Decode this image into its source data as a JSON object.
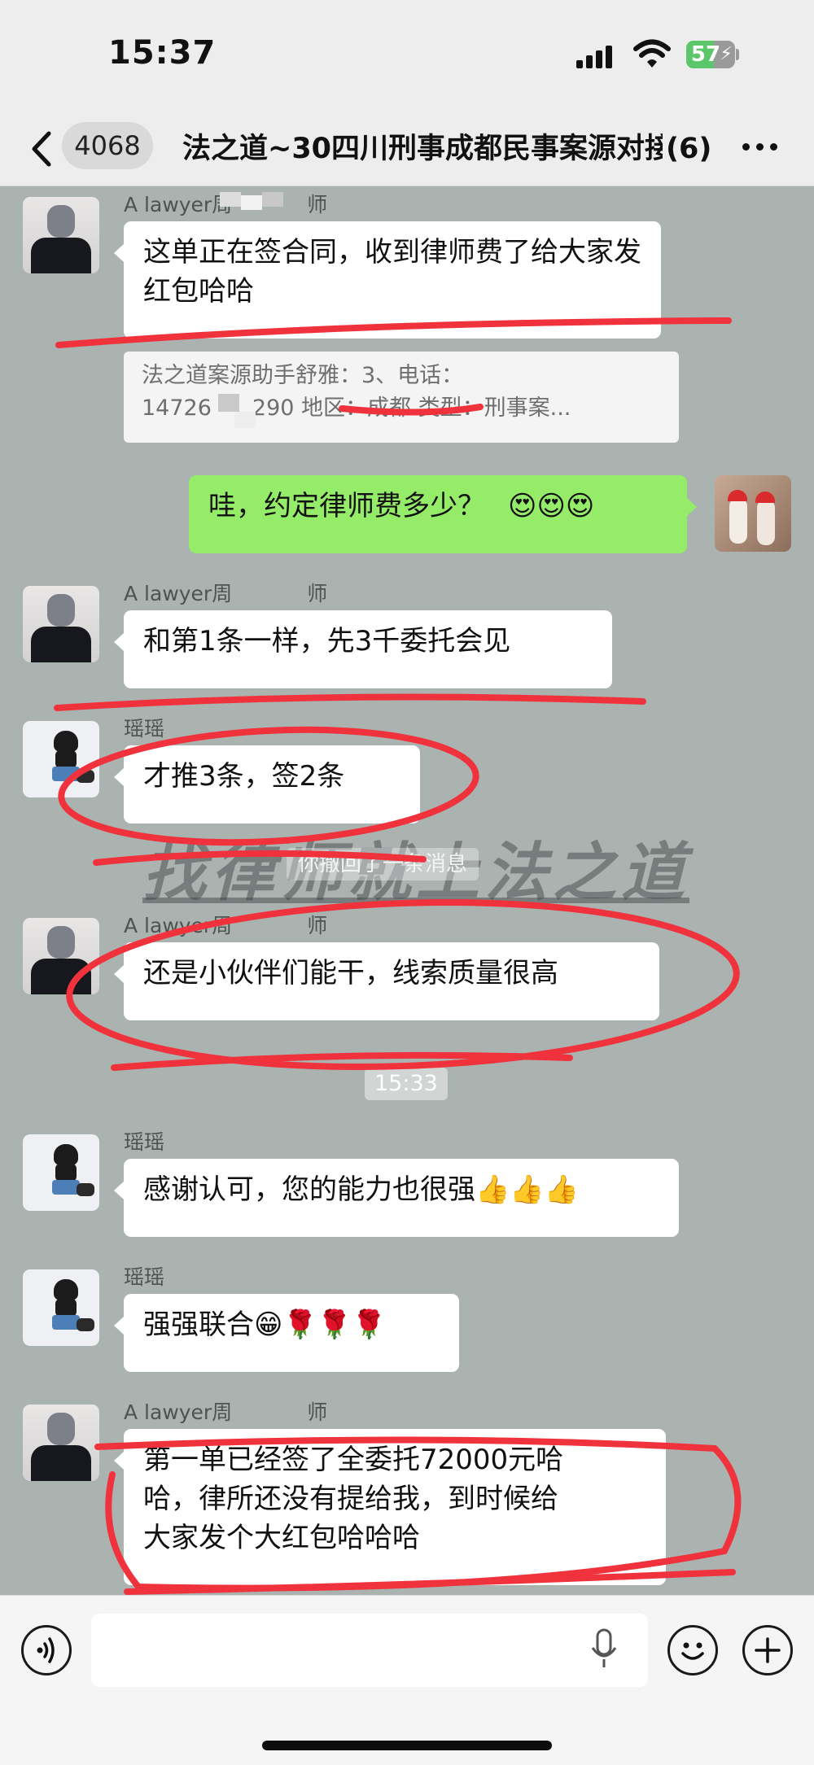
{
  "status_bar": {
    "time": "15:37",
    "battery": "57",
    "battery_level": 0.57
  },
  "nav": {
    "unread_count": "4068",
    "title": "法之道~30四川刑事成都民事案源对接",
    "member_count": "(6)"
  },
  "colors": {
    "chat_background": "#abb3b0",
    "sent_bubble": "#95ec69",
    "annotation_red": "#f0323c"
  },
  "messages": [
    {
      "sender": "A lawyer周",
      "sender_suffix": "师",
      "text": "这单正在签合同，收到律师费了给大家发红包哈哈"
    },
    {
      "quote_line1": "法之道案源助手舒雅：3、电话：",
      "quote_line2_a": "14726",
      "quote_line2_b": "290 地区：成都 类型：刑事案..."
    },
    {
      "sender": "me",
      "text": "哇，约定律师费多少？",
      "emoji": "😍😍😍"
    },
    {
      "sender": "A lawyer周",
      "sender_suffix": "师",
      "text": "和第1条一样，先3千委托会见"
    },
    {
      "sender": "瑶瑶",
      "text": "才推3条，签2条"
    },
    {
      "system": "你撤回了一条消息"
    },
    {
      "sender": "A lawyer周",
      "sender_suffix": "师",
      "text": "还是小伙伴们能干，线索质量很高"
    },
    {
      "time": "15:33"
    },
    {
      "sender": "瑶瑶",
      "text": "感谢认可，您的能力也很强",
      "emoji": "👍👍👍"
    },
    {
      "sender": "瑶瑶",
      "text": "强强联合",
      "emoji": "😁🌹🌹🌹"
    },
    {
      "sender": "A lawyer周",
      "sender_suffix": "师",
      "text_line1": "第一单已经签了全委托72000元哈",
      "text_line2": "哈，律所还没有提给我，到时候给",
      "text_line3": "大家发个大红包哈哈哈"
    }
  ],
  "watermark": "找律师就上法之道",
  "input": {
    "placeholder": ""
  },
  "icons": [
    "back-icon",
    "more-icon",
    "voice-icon",
    "mic-icon",
    "emoji-icon",
    "plus-icon"
  ]
}
